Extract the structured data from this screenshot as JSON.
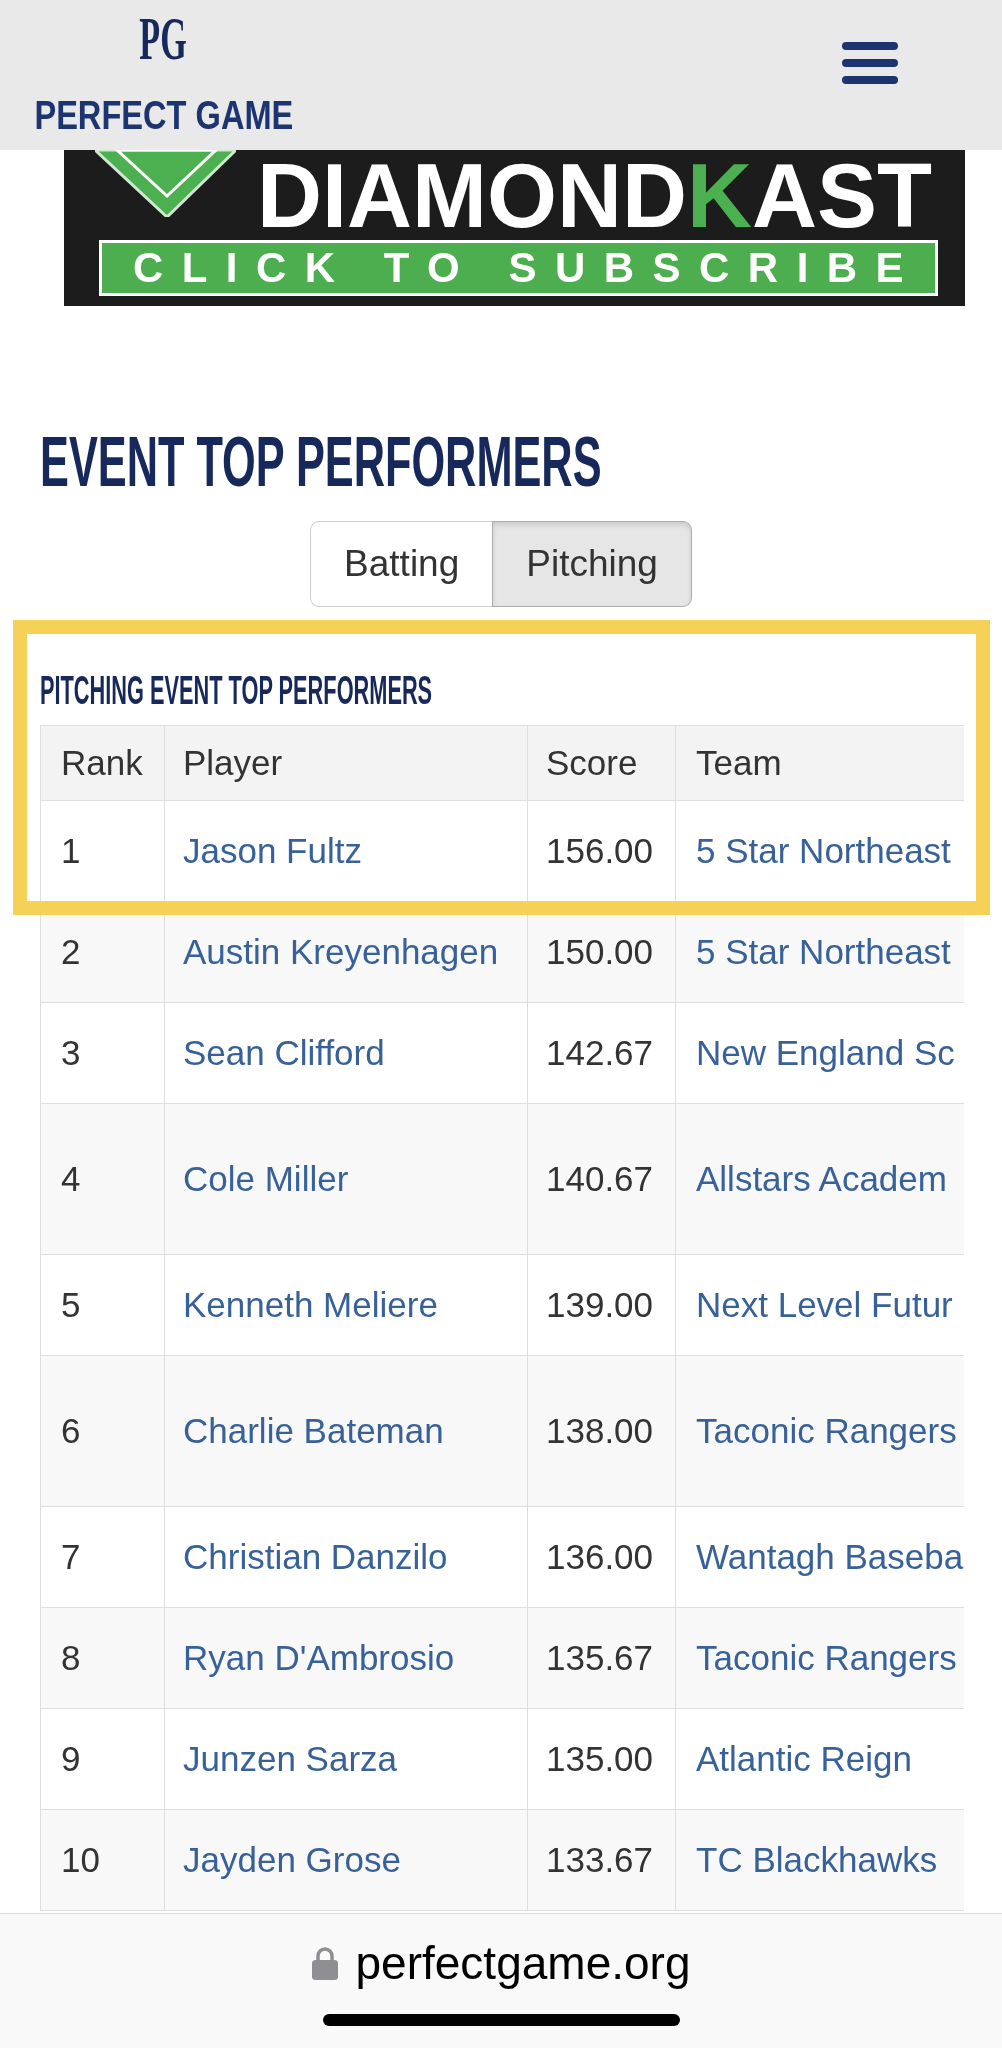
{
  "header": {
    "logo_mark": "PG",
    "logo_text": "PERFECT GAME"
  },
  "banner": {
    "wordmark": [
      {
        "text": "DIAMOND",
        "accent": false
      },
      {
        "text": "K",
        "accent": true
      },
      {
        "text": "AST",
        "accent": false
      }
    ],
    "button": "CLICK TO SUBSCRIBE"
  },
  "title": "EVENT TOP PERFORMERS",
  "tabs": [
    {
      "label": "Batting",
      "selected": false
    },
    {
      "label": "Pitching",
      "selected": true
    }
  ],
  "section": {
    "title": "PITCHING EVENT TOP PERFORMERS",
    "columns": [
      "Rank",
      "Player",
      "Score",
      "Team"
    ],
    "rows": [
      {
        "rank": "1",
        "player": "Jason Fultz",
        "score": "156.00",
        "team": "5 Star Northeast",
        "highlighted": true,
        "kind": "regular"
      },
      {
        "rank": "2",
        "player": "Austin Kreyenhagen",
        "score": "150.00",
        "team": "5 Star Northeast",
        "highlighted": false,
        "kind": "regular"
      },
      {
        "rank": "3",
        "player": "Sean Clifford",
        "score": "142.67",
        "team": "New England Sc",
        "highlighted": false,
        "kind": "regular"
      },
      {
        "rank": "4",
        "player": "Cole Miller",
        "score": "140.67",
        "team": "Allstars Academ",
        "highlighted": false,
        "kind": "tall"
      },
      {
        "rank": "5",
        "player": "Kenneth Meliere",
        "score": "139.00",
        "team": "Next Level Futur",
        "highlighted": false,
        "kind": "regular"
      },
      {
        "rank": "6",
        "player": "Charlie Bateman",
        "score": "138.00",
        "team": "Taconic Rangers",
        "highlighted": false,
        "kind": "tall"
      },
      {
        "rank": "7",
        "player": "Christian Danzilo",
        "score": "136.00",
        "team": "Wantagh Baseba",
        "highlighted": false,
        "kind": "regular"
      },
      {
        "rank": "8",
        "player": "Ryan D'Ambrosio",
        "score": "135.67",
        "team": "Taconic Rangers",
        "highlighted": false,
        "kind": "regular"
      },
      {
        "rank": "9",
        "player": "Junzen Sarza",
        "score": "135.00",
        "team": "Atlantic Reign",
        "highlighted": false,
        "kind": "regular"
      },
      {
        "rank": "10",
        "player": "Jayden Grose",
        "score": "133.67",
        "team": "TC Blackhawks",
        "highlighted": false,
        "kind": "regular"
      }
    ]
  },
  "address_bar": {
    "url": "perfectgame.org"
  }
}
